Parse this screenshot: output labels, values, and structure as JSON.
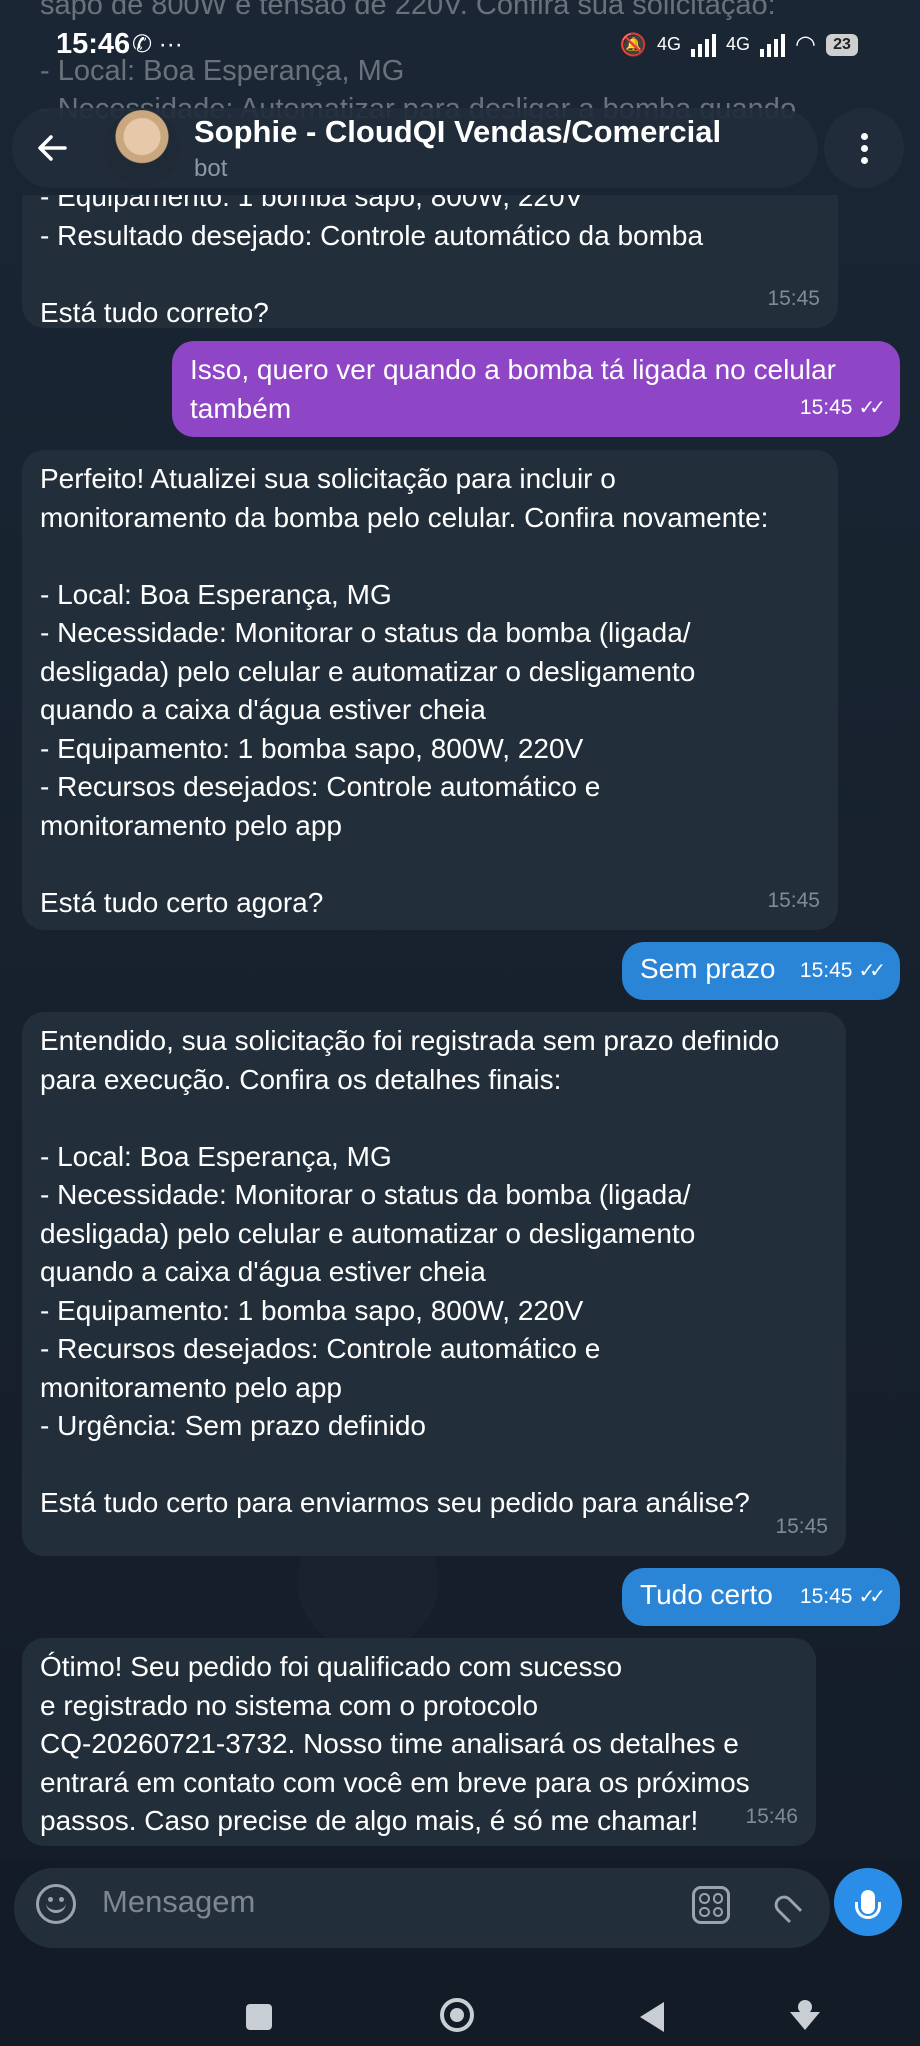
{
  "status_bar": {
    "time": "15:46",
    "left_icons": "✆ ···",
    "net1": "4G",
    "net2": "4G",
    "battery": "23"
  },
  "chat": {
    "title": "Sophie - CloudQI Vendas/Comercial",
    "subtitle": "bot"
  },
  "faded_top_lines": [
    "sapo de 800W e tensão de 220V. Confira sua solicitação:",
    "- Local: Boa Esperança, MG",
    "- Necessidade: Automatizar para desligar a bomba quando"
  ],
  "messages": [
    {
      "dir": "in",
      "text": "- Equipamento: 1 bomba sapo, 800W, 220V\n- Resultado desejado: Controle automático da bomba\n\nEstá tudo correto?",
      "time": "15:45"
    },
    {
      "dir": "out",
      "text": "Isso, quero ver quando a bomba tá ligada no celular\ntambém",
      "time": "15:45"
    },
    {
      "dir": "in",
      "text": "Perfeito! Atualizei sua solicitação para incluir o\nmonitoramento da bomba pelo celular. Confira novamente:\n\n- Local: Boa Esperança, MG\n- Necessidade: Monitorar o status da bomba (ligada/\ndesligada) pelo celular e automatizar o desligamento\nquando a caixa d'água estiver cheia\n- Equipamento: 1 bomba sapo, 800W, 220V\n- Recursos desejados: Controle automático e\nmonitoramento pelo app\n\nEstá tudo certo agora?",
      "time": "15:45"
    },
    {
      "dir": "out",
      "text": "Sem prazo",
      "time": "15:45"
    },
    {
      "dir": "in",
      "text": "Entendido, sua solicitação foi registrada sem prazo definido\npara execução. Confira os detalhes finais:\n\n- Local: Boa Esperança, MG\n- Necessidade: Monitorar o status da bomba (ligada/\ndesligada) pelo celular e automatizar o desligamento\nquando a caixa d'água estiver cheia\n- Equipamento: 1 bomba sapo, 800W, 220V\n- Recursos desejados: Controle automático e\nmonitoramento pelo app\n- Urgência: Sem prazo definido\n\nEstá tudo certo para enviarmos seu pedido para análise?",
      "time": "15:45"
    },
    {
      "dir": "out",
      "text": "Tudo certo",
      "time": "15:45"
    },
    {
      "dir": "in",
      "text": "Ótimo! Seu pedido foi qualificado com sucesso\ne registrado no sistema com o protocolo\nCQ-20260721-3732. Nosso time analisará os detalhes e\nentrará em contato com você em breve para os próximos\npassos. Caso precise de algo mais, é só me chamar!",
      "time": "15:46"
    }
  ],
  "composer": {
    "placeholder": "Mensagem"
  },
  "colors": {
    "incoming_bubble": "#222e3a",
    "outgoing_purple": "#8e46c6",
    "outgoing_blue": "#2a85d6",
    "mic_button": "#2a8de8"
  },
  "icons": [
    "back-arrow-icon",
    "more-vertical-icon",
    "emoji-icon",
    "sticker-icon",
    "attach-icon",
    "mic-icon",
    "double-check-icon"
  ]
}
